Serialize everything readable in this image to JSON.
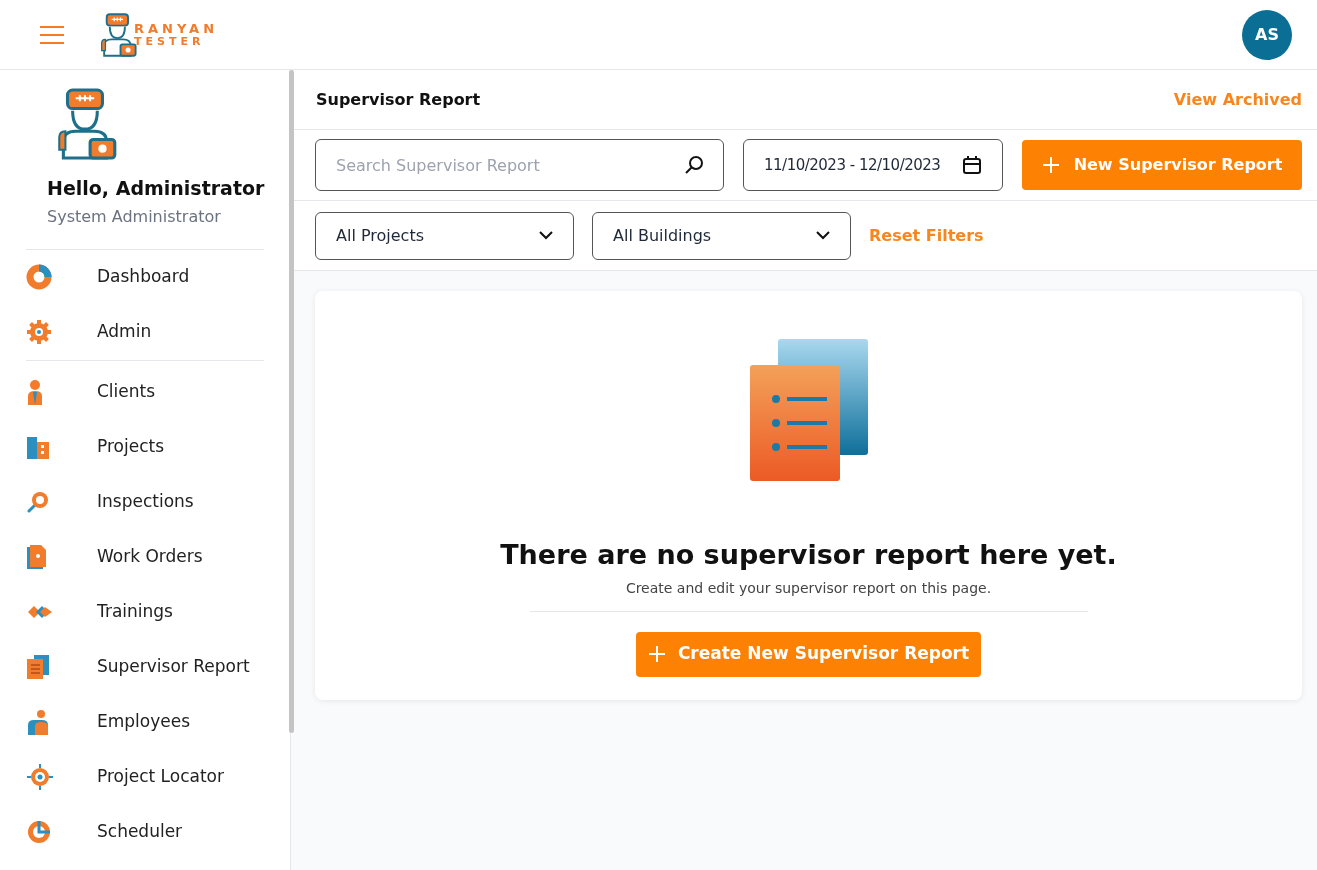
{
  "header": {
    "logo_line_1": "RANYAN",
    "logo_line_2": "TESTER",
    "avatar_initials": "AS"
  },
  "sidebar": {
    "greeting": "Hello, Administrator",
    "role": "System Administrator",
    "groups": [
      [
        {
          "label": "Dashboard"
        },
        {
          "label": "Admin"
        }
      ],
      [
        {
          "label": "Clients"
        },
        {
          "label": "Projects"
        },
        {
          "label": "Inspections"
        },
        {
          "label": "Work Orders"
        },
        {
          "label": "Trainings"
        },
        {
          "label": "Supervisor Report"
        },
        {
          "label": "Employees"
        },
        {
          "label": "Project Locator"
        },
        {
          "label": "Scheduler"
        }
      ]
    ]
  },
  "page": {
    "title": "Supervisor Report",
    "view_archived": "View Archived",
    "search": {
      "placeholder": "Search Supervisor Report"
    },
    "date_range": "11/10/2023 - 12/10/2023",
    "new_button": "New Supervisor Report",
    "filters": [
      "All Projects",
      "All Buildings"
    ],
    "reset_filters": "Reset Filters",
    "empty_state": {
      "title": "There are no supervisor report here yet.",
      "subtitle": "Create and edit your supervisor report on this page.",
      "button": "Create New Supervisor Report"
    }
  }
}
